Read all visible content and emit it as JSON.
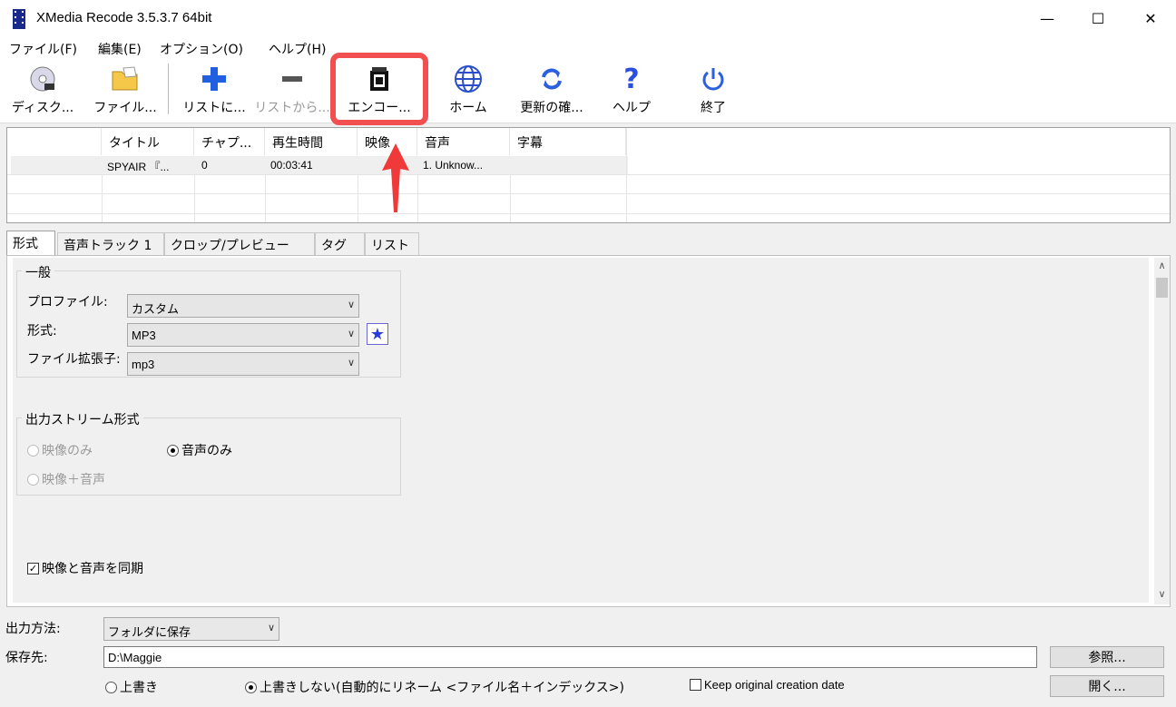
{
  "window": {
    "title": "XMedia Recode 3.5.3.7 64bit",
    "minimize_glyph": "—",
    "maximize_glyph": "☐",
    "close_glyph": "✕"
  },
  "menu": [
    "ファイル(F)",
    "編集(E)",
    "オプション(O)",
    "ヘルプ(H)"
  ],
  "toolbar": {
    "disc": "ディスク...",
    "file": "ファイル...",
    "add": "リストに...",
    "remove": "リストから...",
    "encode": "エンコー...",
    "home": "ホーム",
    "update": "更新の確...",
    "help": "ヘルプ",
    "exit": "終了"
  },
  "filelist": {
    "headers": [
      "タイトル",
      "チャプ...",
      "再生時間",
      "映像",
      "音声",
      "字幕"
    ],
    "row": [
      "SPYAIR 『...",
      "0",
      "00:03:41",
      "",
      "1. Unknow...",
      ""
    ]
  },
  "tabs": [
    "形式",
    "音声トラック 1",
    "クロップ/プレビュー",
    "タグ",
    "リスト"
  ],
  "general": {
    "group_title": "一般",
    "profile_label": "プロファイル:",
    "profile_value": "カスタム",
    "format_label": "形式:",
    "format_value": "MP3",
    "ext_label": "ファイル拡張子:",
    "ext_value": "mp3"
  },
  "stream": {
    "group_title": "出力ストリーム形式",
    "video_only": "映像のみ",
    "audio_only": "音声のみ",
    "video_audio": "映像＋音声"
  },
  "sync_label": "映像と音声を同期",
  "output": {
    "method_label": "出力方法:",
    "method_value": "フォルダに保存",
    "dest_label": "保存先:",
    "dest_value": "D:\\Maggie",
    "browse": "参照...",
    "open": "開く...",
    "overwrite": "上書き",
    "no_overwrite": "上書きしない(自動的にリネーム <ファイル名＋インデックス>)",
    "keep_date": "Keep original creation date"
  },
  "colors": {
    "highlight": "#f25050",
    "accent_blue": "#1f5fe0"
  }
}
